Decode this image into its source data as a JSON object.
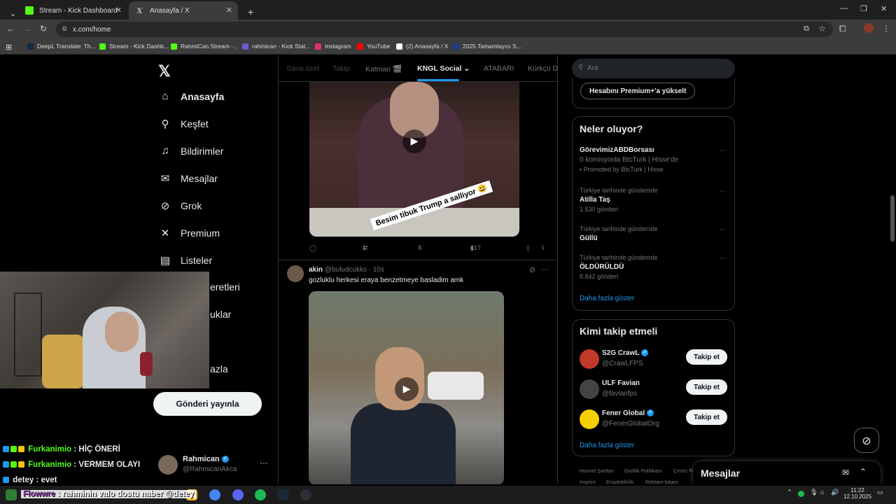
{
  "browser": {
    "tabs": [
      {
        "title": "Stream - Kick Dashboard",
        "color": "#53fc18"
      },
      {
        "title": "Anasayfa / X",
        "color": "#ffffff"
      }
    ],
    "url": "x.com/home",
    "bookmarks": [
      "DeepL Translate: Th...",
      "Stream - Kick Dashb...",
      "RahmiCan Stream -...",
      "rahmican - Kick Stat...",
      "Instagram",
      "YouTube",
      "(2) Anasayfa / X",
      "2025 Tamamlayıcı S..."
    ]
  },
  "sidebar": {
    "items": [
      {
        "label": "Anasayfa",
        "icon": "home-icon"
      },
      {
        "label": "Keşfet",
        "icon": "search-icon"
      },
      {
        "label": "Bildirimler",
        "icon": "bell-icon"
      },
      {
        "label": "Mesajlar",
        "icon": "envelope-icon"
      },
      {
        "label": "Grok",
        "icon": "grok-icon"
      },
      {
        "label": "Premium",
        "icon": "x-icon"
      },
      {
        "label": "Listeler",
        "icon": "list-icon"
      },
      {
        "label": "eretleri",
        "icon": "bookmark-icon"
      },
      {
        "label": "uklar",
        "icon": "community-icon"
      },
      {
        "label": "azla",
        "icon": "more-icon"
      }
    ],
    "post_button": "Gönderi yayınla",
    "profile": {
      "name": "Rahmican",
      "handle": "@RahmicanAkca"
    }
  },
  "feed": {
    "tabs": [
      "Sana özel",
      "Takip",
      "Katman 🎬",
      "KNGL Social",
      "ATABARI",
      "Kürkçü D"
    ],
    "active_tab": "KNGL Social",
    "tweet1": {
      "video_caption": "Besim tibuk Trump a salliyor 😃",
      "retweets": "1",
      "likes": "8",
      "views": "617"
    },
    "tweet2": {
      "name": "akin",
      "handle": "@buludcukks",
      "time": "· 10s",
      "text": "gozluklu herkesi eraya benzetmeye basladim amk"
    }
  },
  "right": {
    "search_placeholder": "Ara",
    "premium_button": "Hesabını Premium+'a yükselt",
    "trends_title": "Neler oluyor?",
    "trends": [
      {
        "subtitle": "",
        "title": "GörevimizABDBorsası",
        "meta": "0 komisyonla BtcTurk | Hisse'de",
        "promo": "Promoted by BtcTurk | Hisse"
      },
      {
        "subtitle": "Türkiye tarihinde gündemde",
        "title": "Atilla Taş",
        "meta": "1.530 gönderi"
      },
      {
        "subtitle": "Türkiye tarihinde gündemde",
        "title": "Güllü",
        "meta": ""
      },
      {
        "subtitle": "Türkiye tarihinde gündemde",
        "title": "ÖLDÜRÜLDÜ",
        "meta": "8.842 gönderi"
      }
    ],
    "show_more": "Daha fazla göster",
    "follow_title": "Kimi takip etmeli",
    "follow": [
      {
        "name": "S2G CrawL",
        "handle": "@CrawLFPS",
        "button": "Takip et",
        "color": "#c0392b"
      },
      {
        "name": "ULF Favian",
        "handle": "@favianfps",
        "button": "Takip et",
        "color": "#444444"
      },
      {
        "name": "Fener Global",
        "handle": "@FenerGlobalOrg",
        "button": "Takip et",
        "color": "#f5d000"
      }
    ],
    "footer": [
      "Hizmet Şartları",
      "Gizlilik Politikası",
      "Çerez Po",
      "Imprint",
      "Erişilebilirlik",
      "Reklam bilgisi"
    ],
    "messages_dock": "Mesajlar"
  },
  "chat": [
    {
      "user": "Furkanimio",
      "msg": " : HİÇ ÖNERİ"
    },
    {
      "user": "Furkanimio",
      "msg": " : VERMEM OLAYI"
    },
    {
      "user": "detey",
      "msg": " : evet"
    },
    {
      "user": "Flowwre",
      "msg": " : rahminin valo dostu naber @detey"
    }
  ],
  "taskbar": {
    "time": "11:22",
    "date": "12.10.2025"
  }
}
